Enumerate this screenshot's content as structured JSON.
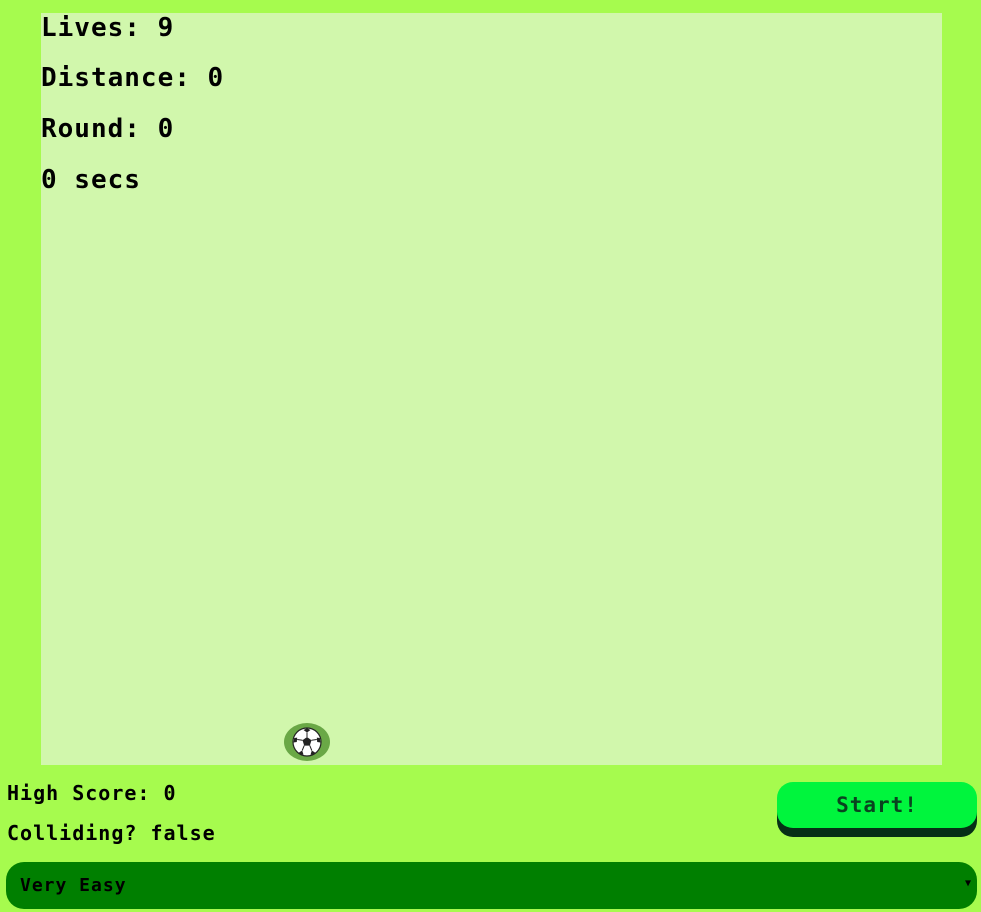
{
  "hud": {
    "lives": "Lives: 9",
    "distance": "Distance: 0",
    "round": "Round: 0",
    "timer": "0 secs"
  },
  "player": {
    "icon": "soccer-ball-icon"
  },
  "footer": {
    "high_score": "High Score: 0",
    "colliding": "Colliding? false",
    "start_label": "Start!"
  },
  "difficulty": {
    "selected": "Very Easy"
  },
  "colors": {
    "background": "#a6fb4e",
    "field": "#d1f7ac",
    "start_button": "#00f53d",
    "select_bg": "#007f00"
  }
}
